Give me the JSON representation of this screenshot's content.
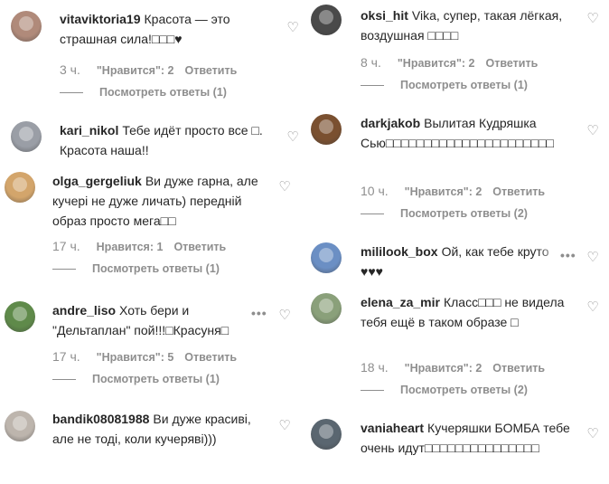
{
  "left": [
    {
      "username": "vitaviktoria19",
      "text": "Красота — это страшная сила!□□□♥",
      "time": "3 ч.",
      "likes": "\"Нравится\": 2",
      "reply": "Ответить",
      "view_replies": "Посмотреть ответы (1)",
      "avatar_color": "#b08a7a"
    },
    {
      "username": "kari_nikol",
      "text": "Тебе идёт просто все □. Красота наша!!",
      "avatar_color": "#9a9ea6"
    },
    {
      "username": "olga_gergeliuk",
      "text": "Ви дуже гарна, але кучері не дуже личать) передній образ просто мега□□",
      "time": "17 ч.",
      "likes": "Нравится: 1",
      "reply": "Ответить",
      "view_replies": "Посмотреть ответы (1)",
      "avatar_color": "#d3a56b"
    },
    {
      "username": "andre_liso",
      "text": "Хоть бери и \"Дельтаплан\" пой!!!□Красуня□",
      "time": "17 ч.",
      "likes": "\"Нравится\": 5",
      "reply": "Ответить",
      "view_replies": "Посмотреть ответы (1)",
      "more": "•••",
      "avatar_color": "#5f8a4a"
    },
    {
      "username": "bandik08081988",
      "text": "Ви дуже красиві, але не тоді, коли кучеряві)))",
      "avatar_color": "#bdb5ad"
    }
  ],
  "right": [
    {
      "username": "oksi_hit",
      "text": "Vika, супер, такая лёгкая, воздушная □□□□",
      "time": "8 ч.",
      "likes": "\"Нравится\": 2",
      "reply": "Ответить",
      "view_replies": "Посмотреть ответы (1)",
      "avatar_color": "#4a4a4a"
    },
    {
      "username": "darkjakob",
      "text": "Вылитая Кудряшка Сью□□□□□□□□□□□□□□□□□□□□□□",
      "time": "10 ч.",
      "likes": "\"Нравится\": 2",
      "reply": "Ответить",
      "view_replies": "Посмотреть ответы (2)",
      "avatar_color": "#7a5030"
    },
    {
      "username": "mililook_box",
      "text": "Ой, как тебе круто ♥♥♥",
      "more": "•••",
      "avatar_color": "#6b8fc4"
    },
    {
      "username": "elena_za_mir",
      "text": "Класс□□□ не видела тебя ещё в таком образе □",
      "time": "18 ч.",
      "likes": "\"Нравится\": 2",
      "reply": "Ответить",
      "view_replies": "Посмотреть ответы (2)",
      "avatar_color": "#8aa07a"
    },
    {
      "username": "vaniaheart",
      "text": "Кучеряшки БОМБА тебе очень идут□□□□□□□□□□□□□□□",
      "avatar_color": "#5a6670"
    }
  ]
}
